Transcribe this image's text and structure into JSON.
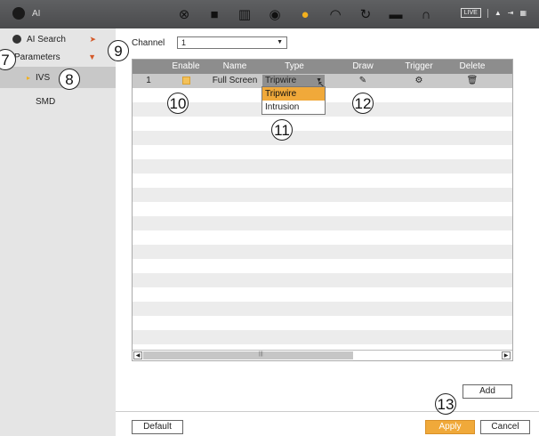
{
  "topbar": {
    "title": "AI",
    "icons": [
      "live-view-icon",
      "playback-icon",
      "storage-icon",
      "network-icon",
      "ai-icon",
      "performance-icon",
      "maintenance-icon",
      "display-icon",
      "audio-icon"
    ],
    "live_label": "LIVE",
    "accent": "#f2b01e"
  },
  "sidebar": {
    "items": [
      {
        "label": "AI Search"
      },
      {
        "label": "Parameters"
      },
      {
        "label": "IVS"
      },
      {
        "label": "SMD"
      }
    ]
  },
  "channel": {
    "label": "Channel",
    "value": "1"
  },
  "table": {
    "headers": [
      "",
      "Enable",
      "Name",
      "Type",
      "Draw",
      "Trigger",
      "Delete"
    ],
    "rows": [
      {
        "index": "1",
        "name": "Full Screen",
        "type": "Tripwire"
      }
    ]
  },
  "type_dropdown": {
    "options": [
      "Tripwire",
      "Intrusion"
    ],
    "highlight": "#f0a93a"
  },
  "buttons": {
    "add": "Add",
    "default": "Default",
    "apply": "Apply",
    "cancel": "Cancel"
  },
  "callouts": [
    "7",
    "8",
    "9",
    "10",
    "11",
    "12",
    "13"
  ]
}
